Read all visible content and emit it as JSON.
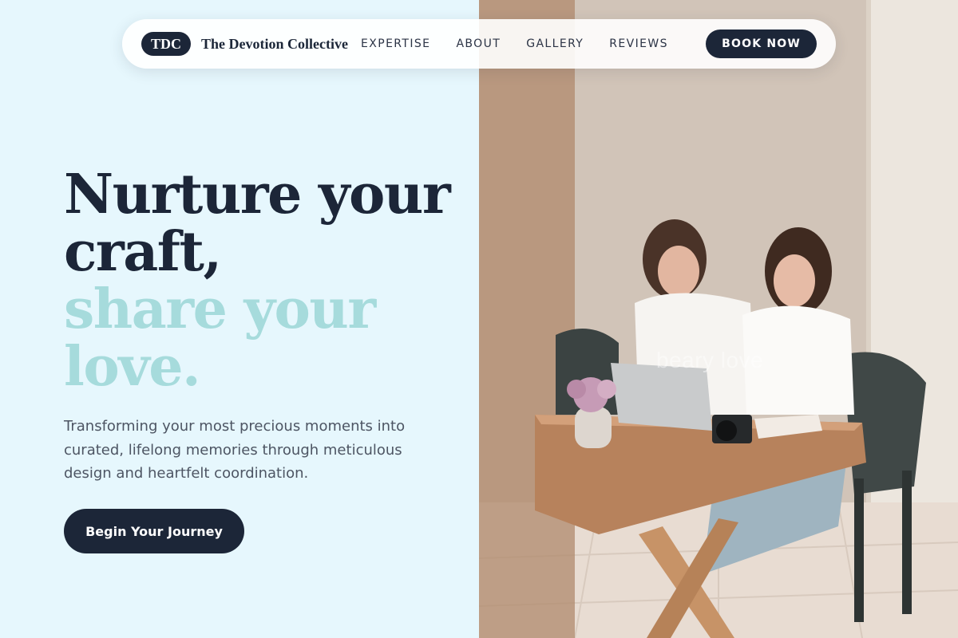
{
  "nav": {
    "logo_badge": "TDC",
    "logo_text": "The Devotion Collective",
    "links": [
      {
        "label": "EXPERTISE"
      },
      {
        "label": "ABOUT"
      },
      {
        "label": "GALLERY"
      },
      {
        "label": "REVIEWS"
      }
    ],
    "cta_label": "BOOK NOW"
  },
  "hero": {
    "headline_dark": [
      "Nurture your",
      "craft,"
    ],
    "headline_light": [
      "share your",
      "love."
    ],
    "subtext": "Transforming your most precious moments into curated, lifelong memories through meticulous design and heartfelt coordination.",
    "cta_label": "Begin Your Journey"
  },
  "photo": {
    "watermark": "beary love"
  },
  "colors": {
    "background": "#e6f7fd",
    "navy": "#1c2638",
    "accent_teal": "#a6dbdc",
    "body_text": "#4d5563"
  }
}
